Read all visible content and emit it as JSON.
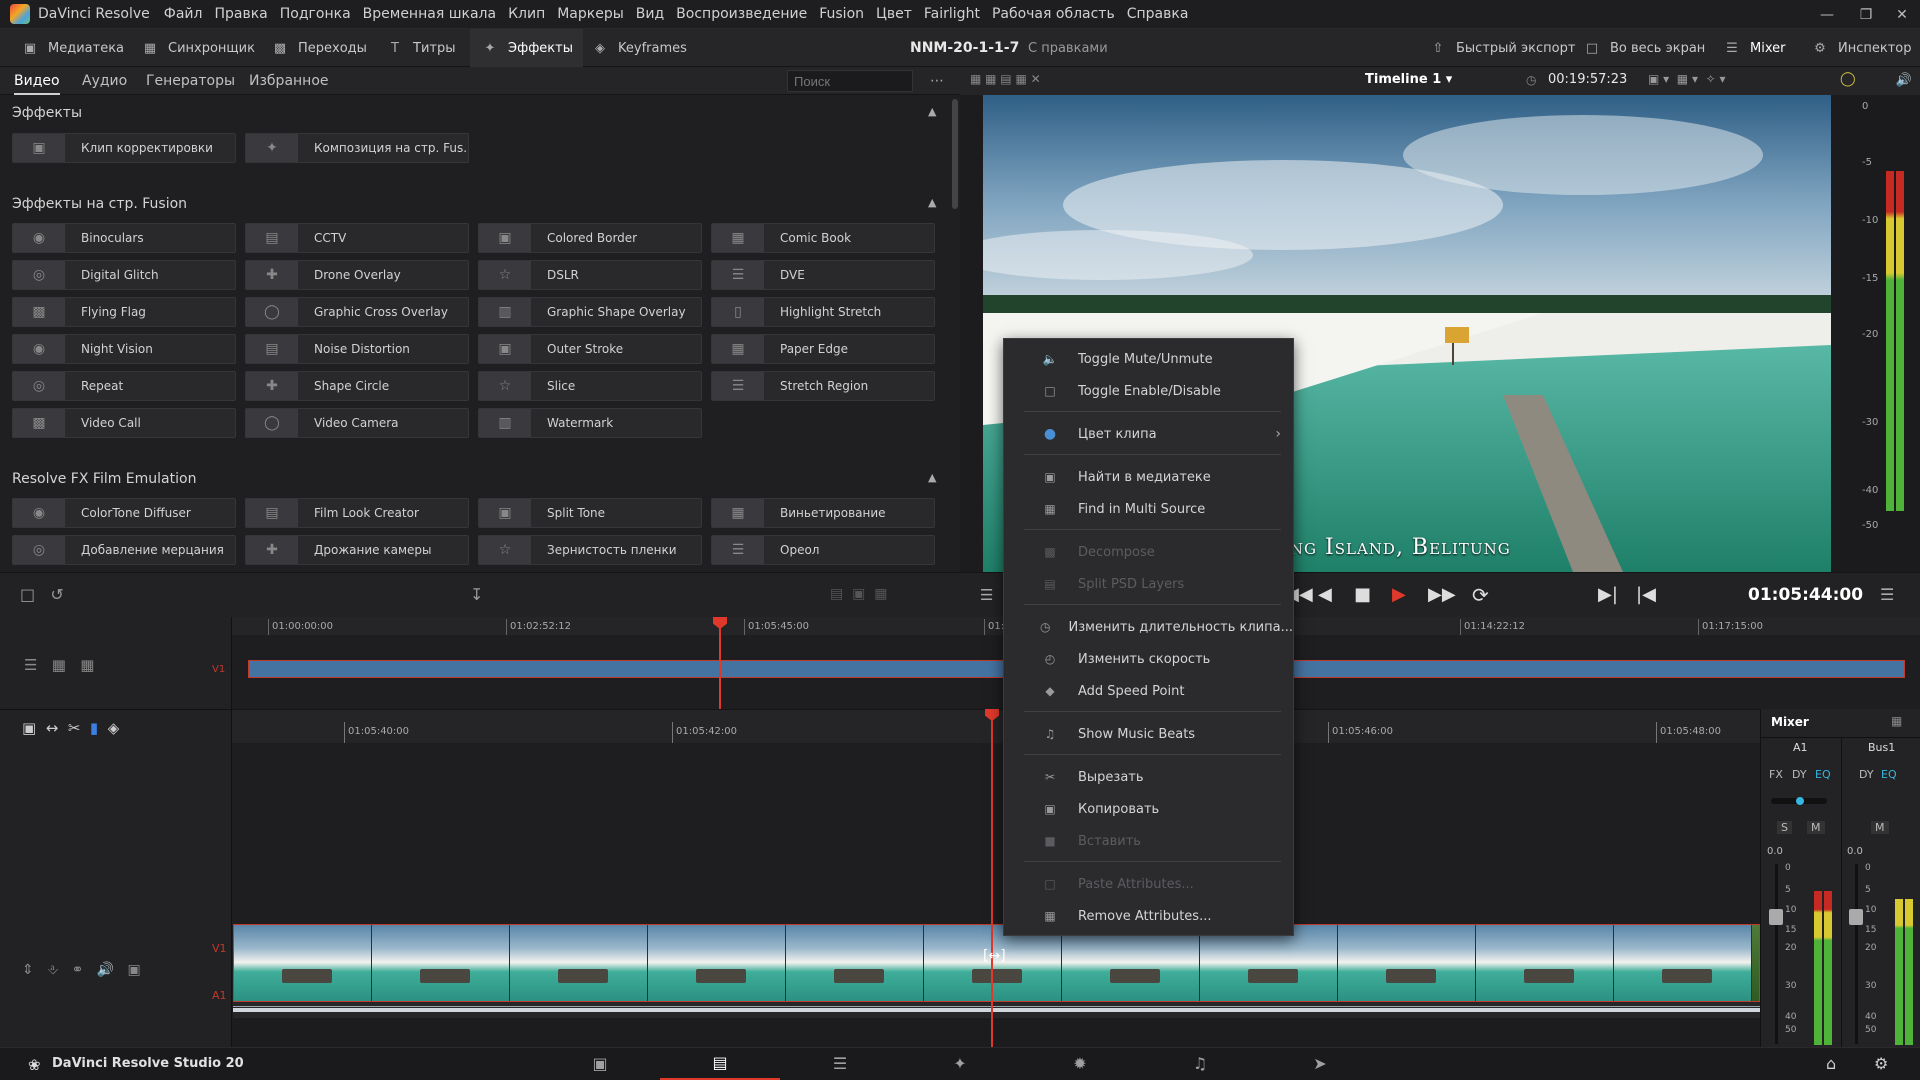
{
  "app": {
    "name": "DaVinci Resolve",
    "edition_label": "DaVinci Resolve Studio 20"
  },
  "menu": [
    "Файл",
    "Правка",
    "Подгонка",
    "Временная шкала",
    "Клип",
    "Маркеры",
    "Вид",
    "Воспроизведение",
    "Fusion",
    "Цвет",
    "Fairlight",
    "Рабочая область",
    "Справка"
  ],
  "toolbar": {
    "media_pool": "Медиатека",
    "sync": "Синхронщик",
    "transitions": "Переходы",
    "titles": "Титры",
    "effects": "Эффекты",
    "keyframes": "Keyframes",
    "project_name": "NNM-20-1-1-7",
    "project_status": "С правками",
    "quick_export": "Быстрый экспорт",
    "fullscreen": "Во весь экран",
    "mixer": "Mixer",
    "inspector": "Инспектор"
  },
  "effects_tabs": [
    "Видео",
    "Аудио",
    "Генераторы",
    "Избранное"
  ],
  "search_placeholder": "Поиск",
  "sections": {
    "effects": "Эффекты",
    "fusion": "Эффекты на стр. Fusion",
    "film": "Resolve FX Film Emulation"
  },
  "effects_items": [
    "Клип корректировки",
    "Композиция на стр. Fus..."
  ],
  "fusion_items": [
    "Binoculars",
    "CCTV",
    "Colored Border",
    "Comic Book",
    "Digital Glitch",
    "Drone Overlay",
    "DSLR",
    "DVE",
    "Flying Flag",
    "Graphic Cross Overlay",
    "Graphic Shape Overlay",
    "Highlight Stretch",
    "Night Vision",
    "Noise Distortion",
    "Outer Stroke",
    "Paper Edge",
    "Repeat",
    "Shape Circle",
    "Slice",
    "Stretch Region",
    "Video Call",
    "Video Camera",
    "Watermark"
  ],
  "film_items": [
    "ColorTone Diffuser",
    "Film Look Creator",
    "Split Tone",
    "Виньетирование",
    "Добавление мерцания",
    "Дрожание камеры",
    "Зернистость пленки",
    "Ореол"
  ],
  "viewer": {
    "timeline_name": "Timeline 1",
    "source_timecode": "00:19:57:23",
    "caption": "Keebong Island, Belitung",
    "current_timecode": "01:05:44:00"
  },
  "meter_scale": [
    "0",
    "-5",
    "-10",
    "-15",
    "-20",
    "-30",
    "-40",
    "-50"
  ],
  "overview_ruler": [
    "01:00:00:00",
    "01:02:52:12",
    "01:05:45:00",
    "01:08:3",
    "01:14:22:12",
    "01:17:15:00"
  ],
  "detail_ruler": [
    "01:05:40:00",
    "01:05:42:00",
    "01:05:46:00",
    "01:05:48:00"
  ],
  "tracks": {
    "v1": "V1",
    "a1": "A1"
  },
  "mixer": {
    "title": "Mixer",
    "channels": [
      "A1",
      "Bus1"
    ],
    "a1_buttons": [
      "FX",
      "DY",
      "EQ"
    ],
    "bus_buttons": [
      "DY",
      "EQ"
    ],
    "solo": "S",
    "mute": "M",
    "a1_level": "0.0",
    "bus_level": "0.0",
    "scale": [
      "0",
      "5",
      "10",
      "15",
      "20",
      "30",
      "40",
      "50"
    ]
  },
  "context_menu": [
    {
      "label": "Toggle Mute/Unmute",
      "icon": "speaker-icon",
      "enabled": true
    },
    {
      "label": "Toggle Enable/Disable",
      "icon": "square-icon",
      "enabled": true
    },
    {
      "label": "Цвет клипа",
      "icon": "color-dot-icon",
      "enabled": true,
      "submenu": true
    },
    {
      "label": "Найти в медиатеке",
      "icon": "find-media-icon",
      "enabled": true
    },
    {
      "label": "Find in Multi Source",
      "icon": "multi-source-icon",
      "enabled": true
    },
    {
      "label": "Decompose",
      "icon": "decompose-icon",
      "enabled": false
    },
    {
      "label": "Split PSD Layers",
      "icon": "psd-layers-icon",
      "enabled": false
    },
    {
      "label": "Изменить длительность клипа...",
      "icon": "duration-icon",
      "enabled": true
    },
    {
      "label": "Изменить скорость",
      "icon": "speed-icon",
      "enabled": true
    },
    {
      "label": "Add Speed Point",
      "icon": "speed-point-icon",
      "enabled": true
    },
    {
      "label": "Show Music Beats",
      "icon": "music-beats-icon",
      "enabled": true
    },
    {
      "label": "Вырезать",
      "icon": "cut-icon",
      "enabled": true
    },
    {
      "label": "Копировать",
      "icon": "copy-icon",
      "enabled": true
    },
    {
      "label": "Вставить",
      "icon": "paste-icon",
      "enabled": false
    },
    {
      "label": "Paste Attributes...",
      "icon": "paste-attributes-icon",
      "enabled": false
    },
    {
      "label": "Remove Attributes...",
      "icon": "remove-attributes-icon",
      "enabled": true
    }
  ],
  "colors": {
    "accent_red": "#e0392b",
    "clip_blue": "#4573a1",
    "eq_cyan": "#36b6e0"
  }
}
